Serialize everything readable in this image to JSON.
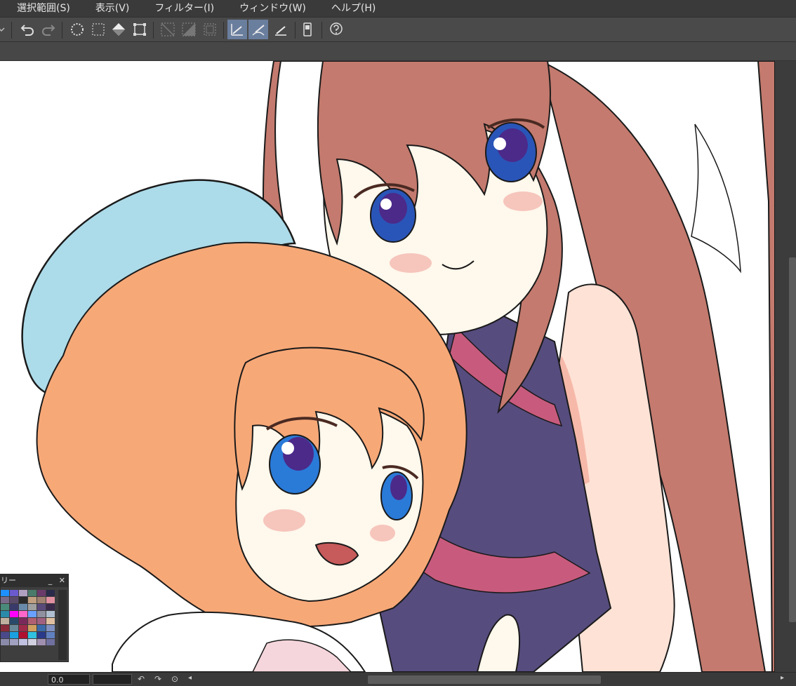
{
  "menu": [
    "選択範囲(S)",
    "表示(V)",
    "フィルター(I)",
    "ウィンドウ(W)",
    "ヘルプ(H)"
  ],
  "toolbar": {
    "icons": [
      "undo-icon",
      "redo-icon",
      "clear-selection-icon",
      "select-all-icon",
      "fill-icon",
      "transform-icon",
      "deselect-icon",
      "invert-selection-icon",
      "selection-border-icon",
      "ruler-snap-icon",
      "special-ruler-snap-icon",
      "grid-snap-icon",
      "companion-app-icon",
      "help-icon"
    ]
  },
  "palette": {
    "title": "リー",
    "minimize_label": "_",
    "close_label": "✕",
    "colors": [
      "#1e90ff",
      "#6a5acd",
      "#b0a0c0",
      "#4a7a6a",
      "#6a3a6a",
      "#2a2a4a",
      "#7a6a8a",
      "#5a4a6a",
      "#2a2a2a",
      "#c0a080",
      "#a08070",
      "#e090a0",
      "#4a8a7a",
      "#3a3a6a",
      "#6a8aaa",
      "#a0a0a0",
      "#5a4a7a",
      "#3a2a4a",
      "#2a8aaa",
      "#ff00ff",
      "#ff66cc",
      "#6aa0ff",
      "#9090a0",
      "#b0c0d0",
      "#c0b0a0",
      "#2a4a6a",
      "#7a2a5a",
      "#b06070",
      "#a06080",
      "#e0c0a0",
      "#8a2a3a",
      "#6a8a9a",
      "#a02a4a",
      "#d0a060",
      "#3a6aaa",
      "#8090c0",
      "#4a4a8a",
      "#1aa0e0",
      "#b01030",
      "#30c0e0",
      "#2a3a8a",
      "#6080c0",
      "#8a8aaa",
      "#a0a0c0",
      "#c0c0e0",
      "#d0d0e0",
      "#a090b0",
      "#7070a0"
    ]
  },
  "status": {
    "zoom": "0.0"
  },
  "colors": {
    "menubar_bg": "#3a3a3a",
    "toolbar_bg": "#4a4a4a",
    "active_tool": "#6a7e9e",
    "line": "#1a1a1a"
  }
}
